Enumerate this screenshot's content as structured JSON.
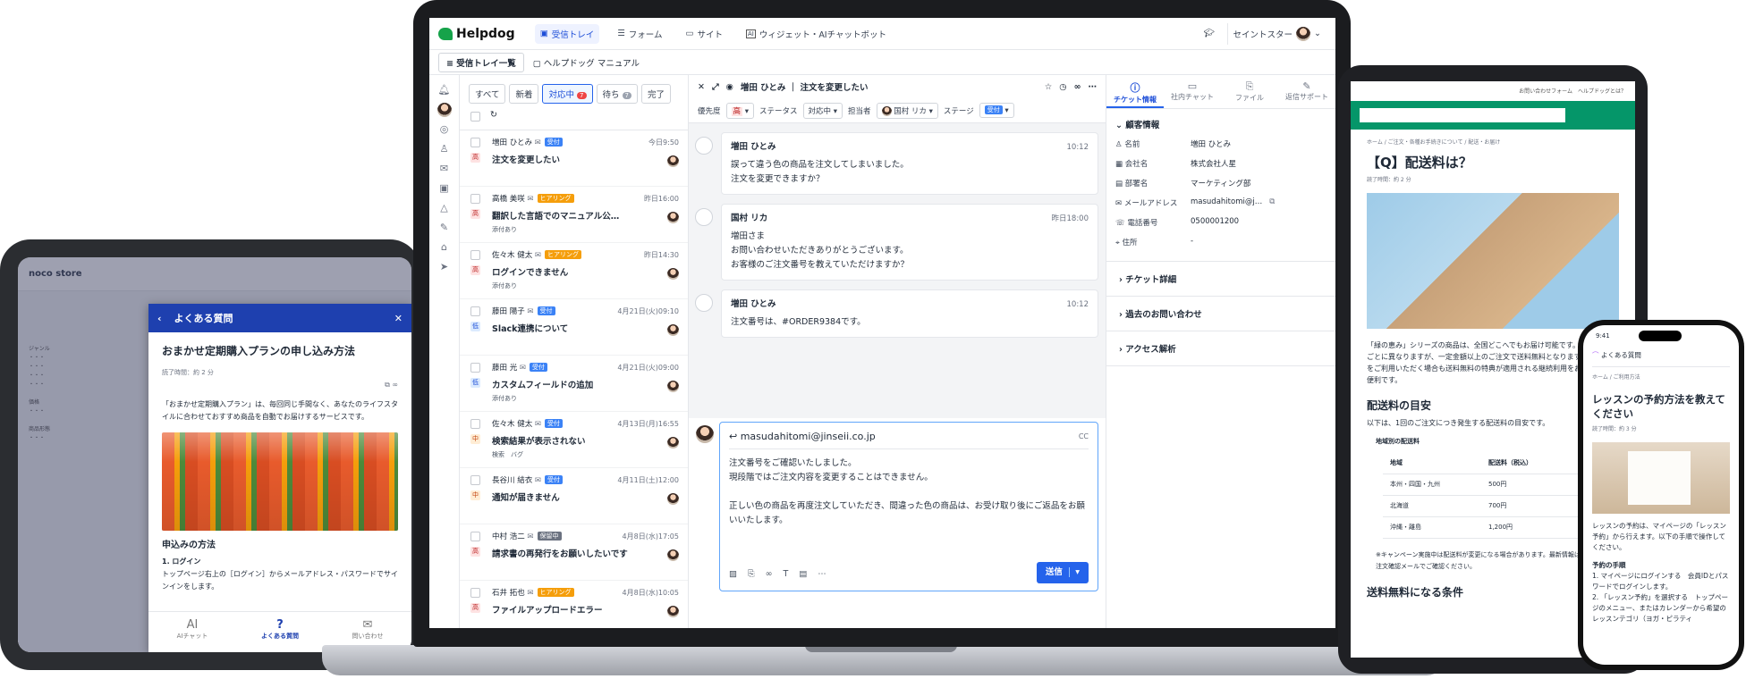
{
  "tablet": {
    "store_name": "noco store",
    "faq_header": "よくある質問",
    "faq_title": "おまかせ定期購入プランの申し込み方法",
    "read_time": "読了時間：約 2 分",
    "intro": "「おまかせ定期購入プラン」は、毎回同じ手間なく、あなたのライフスタイルに合わせておすすめ商品を自動でお届けするサービスです。",
    "section": "申込みの方法",
    "step1_title": "1. ログイン",
    "step1_text": "トップページ右上の［ログイン］からメールアドレス・パスワードでサインインをします。",
    "footer": [
      "AIチャット",
      "よくある質問",
      "問い合わせ"
    ]
  },
  "app": {
    "brand": "Helpdog",
    "nav": [
      "受信トレイ",
      "フォーム",
      "サイト",
      "ウィジェット・AIチャットボット"
    ],
    "org": "セイントスター",
    "sub_button": "受信トレイ一覧",
    "sub_link": "ヘルプドッグ マニュアル",
    "tabs": [
      {
        "label": "すべて"
      },
      {
        "label": "新着"
      },
      {
        "label": "対応中",
        "count": "7"
      },
      {
        "label": "待ち",
        "count": "7"
      },
      {
        "label": "完了"
      }
    ],
    "tickets": [
      {
        "name": "増田 ひとみ",
        "badge": "受付",
        "time": "今日9:50",
        "priority": "高",
        "subject": "注文を変更したい",
        "tags": ""
      },
      {
        "name": "高橋 美咲",
        "badge": "ヒアリング",
        "time": "昨日16:00",
        "priority": "高",
        "subject": "翻訳した言語でのマニュアル公…",
        "tags": "添付あり"
      },
      {
        "name": "佐々木 健太",
        "badge": "ヒアリング",
        "time": "昨日14:30",
        "priority": "高",
        "subject": "ログインできません",
        "tags": "添付あり"
      },
      {
        "name": "藤田 陽子",
        "badge": "受付",
        "time": "4月21日(火)09:10",
        "priority": "低",
        "subject": "Slack連携について",
        "tags": ""
      },
      {
        "name": "藤田 光",
        "badge": "受付",
        "time": "4月21日(火)09:00",
        "priority": "低",
        "subject": "カスタムフィールドの追加",
        "tags": "添付あり"
      },
      {
        "name": "佐々木 健太",
        "badge": "受付",
        "time": "4月13日(月)16:55",
        "priority": "中",
        "subject": "検索結果が表示されない",
        "tags": "検索　バグ"
      },
      {
        "name": "長谷川 結衣",
        "badge": "受付",
        "time": "4月11日(土)12:00",
        "priority": "中",
        "subject": "通知が届きません",
        "tags": ""
      },
      {
        "name": "中村 浩二",
        "badge": "保留中",
        "time": "4月8日(水)17:05",
        "priority": "高",
        "subject": "請求書の再発行をお願いしたいです",
        "tags": ""
      },
      {
        "name": "石井 拓也",
        "badge": "ヒアリング",
        "time": "4月8日(水)10:05",
        "priority": "高",
        "subject": "ファイルアップロードエラー",
        "tags": ""
      }
    ],
    "thread_title": "増田 ひとみ ｜ 注文を変更したい",
    "props": {
      "priority_label": "優先度",
      "priority": "高",
      "status_label": "ステータス",
      "status": "対応中",
      "assignee_label": "担当者",
      "assignee": "国村 リカ",
      "stage_label": "ステージ",
      "stage": "受付"
    },
    "messages": [
      {
        "who": "増田 ひとみ",
        "time": "10:12",
        "text": [
          "誤って違う色の商品を注文してしまいました。",
          "注文を変更できますか？"
        ]
      },
      {
        "who": "国村 リカ",
        "time": "昨日18:00",
        "text": [
          "増田さま",
          "お問い合わせいただきありがとうございます。",
          "お客様のご注文番号を教えていただけますか？"
        ]
      },
      {
        "who": "増田 ひとみ",
        "time": "10:12",
        "text": [
          "注文番号は、#ORDER9384です。"
        ]
      }
    ],
    "reply": {
      "to": "masudahitomi@jinseii.co.jp",
      "cc": "CC",
      "lines": [
        "注文番号をご確認いたしました。",
        "現段階ではご注文内容を変更することはできません。",
        "",
        "正しい色の商品を再度注文していただき、間違った色の商品は、お受け取り後にご返品をお願いいたします。"
      ],
      "send": "送信"
    },
    "side_tabs": [
      "チケット情報",
      "社内チャット",
      "ファイル",
      "返信サポート"
    ],
    "customer_section": "顧客情報",
    "customer": [
      {
        "k": "名前",
        "v": "増田 ひとみ"
      },
      {
        "k": "会社名",
        "v": "株式会社人星"
      },
      {
        "k": "部署名",
        "v": "マーケティング部"
      },
      {
        "k": "メールアドレス",
        "v": "masudahitomi@j…"
      },
      {
        "k": "電話番号",
        "v": "0500001200"
      },
      {
        "k": "住所",
        "v": "-"
      }
    ],
    "accordions": [
      "チケット詳細",
      "過去のお問い合わせ",
      "アクセス解析"
    ]
  },
  "tablet2": {
    "top_links": "お問い合わせフォーム　ヘルプドッグとは？",
    "breadcrumb": "ホーム / ご注文・各種お手続きについて / 配送・お届け",
    "title": "【Q】配送料は？",
    "read_time": "読了時間：約 2 分",
    "body": "「緑の恵み」シリーズの商品は、全国どこへでもお届け可能です。送料は地域ごとに異なりますが、一定金額以上のご注文で送料無料となります。定期購入をご利用いただく場合も送料無料の特典が適用される継続利用をお考えの方に便利です。",
    "h3": "配送料の目安",
    "h3_text": "以下は、1回のご注文につき発生する配送料の目安です。",
    "table_title": "地域別の配送料",
    "table_head": [
      "地域",
      "配送料（税込）"
    ],
    "table_rows": [
      [
        "本州・四国・九州",
        "500円"
      ],
      [
        "北海道",
        "700円"
      ],
      [
        "沖縄・離島",
        "1,200円"
      ]
    ],
    "note": "※キャンペーン実施中は配送料が変更になる場合があります。最新情報は公式サイトや注文確認メールでご確認ください。",
    "h3b": "送料無料になる条件"
  },
  "phone": {
    "time": "9:41",
    "header": "よくある質問",
    "breadcrumb": "ホーム / ご利用方法",
    "title": "レッスンの予約方法を教えてください",
    "read_time": "読了時間：約 3 分",
    "text": "レッスンの予約は、マイページの「レッスン予約」から行えます。以下の手順で操作してください。",
    "steps_title": "予約の手順",
    "steps": [
      "1. マイページにログインする　会員IDとパスワードでログインします。",
      "2. 「レッスン予約」を選択する　トップページのメニュー、またはカレンダーから希望のレッスンテゴリ（ヨガ・ピラティ"
    ]
  }
}
